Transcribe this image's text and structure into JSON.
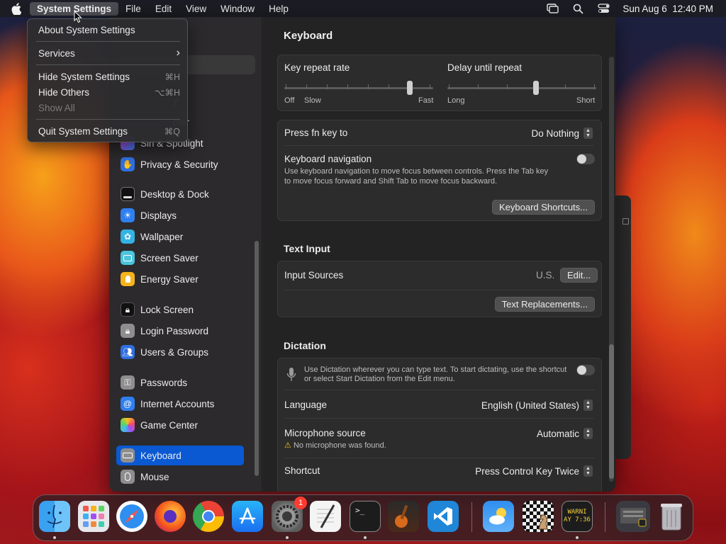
{
  "menubar": {
    "app_name": "System Settings",
    "menus": [
      "File",
      "Edit",
      "View",
      "Window",
      "Help"
    ],
    "clock": "Sun Aug 6  12:40 PM",
    "status_icons": [
      "screen-mirroring-icon",
      "spotlight-search-icon",
      "control-center-icon"
    ]
  },
  "app_menu": {
    "about": "About System Settings",
    "services": "Services",
    "services_arrow": "›",
    "hide": "Hide System Settings",
    "hide_shortcut": "⌘H",
    "hide_others": "Hide Others",
    "hide_others_shortcut": "⌥⌘H",
    "show_all": "Show All",
    "quit": "Quit System Settings",
    "quit_shortcut": "⌘Q"
  },
  "sidebar": {
    "partial_items": [
      "y",
      "nter",
      "Siri & Spotlight"
    ],
    "items": [
      {
        "label": "Privacy & Security",
        "icon": "hand-icon",
        "color": "#2f6fe0"
      },
      {
        "label": "Desktop & Dock",
        "icon": "dock-icon",
        "color": "#1c1c1c"
      },
      {
        "label": "Displays",
        "icon": "sun-icon",
        "color": "#2f7ff0"
      },
      {
        "label": "Wallpaper",
        "icon": "flower-icon",
        "color": "#2fb3e0"
      },
      {
        "label": "Screen Saver",
        "icon": "screensaver-icon",
        "color": "#36b8d8"
      },
      {
        "label": "Energy Saver",
        "icon": "bulb-icon",
        "color": "#f5b31c"
      },
      {
        "label": "Lock Screen",
        "icon": "lock-icon",
        "color": "#1c1c1c"
      },
      {
        "label": "Login Password",
        "icon": "lock-icon",
        "color": "#8a8a8a"
      },
      {
        "label": "Users & Groups",
        "icon": "users-icon",
        "color": "#2f6fe0"
      },
      {
        "label": "Passwords",
        "icon": "key-icon",
        "color": "#8a8a8a"
      },
      {
        "label": "Internet Accounts",
        "icon": "at-icon",
        "color": "#2f7ff0"
      },
      {
        "label": "Game Center",
        "icon": "gamecenter-icon",
        "color": "#e8e8e8"
      },
      {
        "label": "Keyboard",
        "icon": "keyboard-icon",
        "color": "#8a8a8a"
      },
      {
        "label": "Mouse",
        "icon": "mouse-icon",
        "color": "#8a8a8a"
      }
    ],
    "selected": "Keyboard"
  },
  "keyboard": {
    "title": "Keyboard",
    "key_repeat": {
      "label": "Key repeat rate",
      "min_labels": [
        "Off",
        "Slow"
      ],
      "max_label": "Fast",
      "value_fraction": 0.86
    },
    "delay_repeat": {
      "label": "Delay until repeat",
      "min_label": "Long",
      "max_label": "Short",
      "value_fraction": 0.6
    },
    "fn_key": {
      "label": "Press fn key to",
      "value": "Do Nothing"
    },
    "navigation": {
      "label": "Keyboard navigation",
      "description_line1": "Use keyboard navigation to move focus between controls. Press the Tab key",
      "description_line2": "to move focus forward and Shift Tab to move focus backward.",
      "enabled": false
    },
    "shortcuts_button": "Keyboard Shortcuts..."
  },
  "text_input": {
    "title": "Text Input",
    "input_sources_label": "Input Sources",
    "input_sources_value": "U.S.",
    "edit_button": "Edit...",
    "replacements_button": "Text Replacements..."
  },
  "dictation": {
    "title": "Dictation",
    "description_line1": "Use Dictation wherever you can type text. To start dictating, use the shortcut",
    "description_line2": "or select Start Dictation from the Edit menu.",
    "enabled": false,
    "language_label": "Language",
    "language_value": "English (United States)",
    "microphone_label": "Microphone source",
    "microphone_value": "Automatic",
    "microphone_warning": "No microphone was found.",
    "shortcut_label": "Shortcut",
    "shortcut_value": "Press Control Key Twice"
  },
  "dock": {
    "apps": [
      {
        "name": "finder-icon",
        "running": true
      },
      {
        "name": "launchpad-icon",
        "running": false
      },
      {
        "name": "safari-icon",
        "running": false
      },
      {
        "name": "firefox-icon",
        "running": false
      },
      {
        "name": "chrome-icon",
        "running": false
      },
      {
        "name": "app-store-icon",
        "running": false
      },
      {
        "name": "system-settings-icon",
        "running": true,
        "badge": "1"
      },
      {
        "name": "textedit-icon",
        "running": false
      },
      {
        "name": "terminal-icon",
        "running": true
      },
      {
        "name": "garageband-icon",
        "running": false
      },
      {
        "name": "vscode-icon",
        "running": false
      },
      {
        "name": "weather-icon",
        "running": false
      },
      {
        "name": "chess-icon",
        "running": false
      },
      {
        "name": "console-icon",
        "running": true
      },
      {
        "name": "downloads-stack-icon",
        "running": false
      },
      {
        "name": "trash-icon",
        "running": false
      }
    ],
    "console_text_line1": "WARNI",
    "console_text_line2": "AY 7:36"
  }
}
